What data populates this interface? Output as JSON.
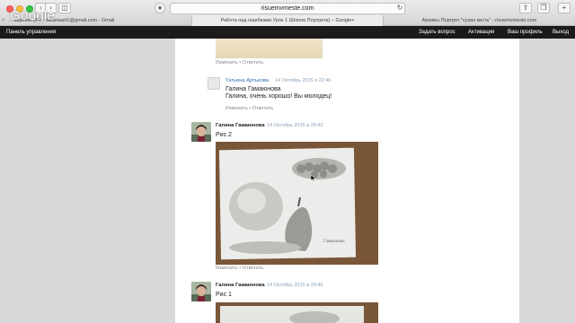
{
  "browser": {
    "url": "risuemvmeste.com",
    "tabs": [
      {
        "label": "…ащение (20) - tatianaart1@gmail.com - Gmail"
      },
      {
        "label": "Работа над ошибками Урок 1 (Школа Портрета) – Google+"
      },
      {
        "label": "Архивы Портрет \"сухая кисть\" - risuemvmeste.com"
      }
    ],
    "watermark": "Google"
  },
  "admin_bar": {
    "left": "Панель управления",
    "ask": "Задать вопрос",
    "activate": "Активация",
    "profile": "Ваш профиль",
    "logout": "Выход"
  },
  "comments": {
    "top_links": "Изменить • Ответить",
    "reply": {
      "author": "Татьяна Артькова",
      "date": "14 Октябрь 2015 в 22:46",
      "line1": "Галина Гамаюнова",
      "line2": "Галина, очень хорошо! Вы молодец!",
      "links": "Изменить • Ответить"
    },
    "c2": {
      "author": "Галина Гамаюнова",
      "date": "14 Октябрь 2015 в 20:42",
      "text": "Рис 2",
      "links": "Изменить • Ответить"
    },
    "c1": {
      "author": "Галина Гамаюнова",
      "date": "14 Октябрь 2015 в 20:40",
      "text": "Рис 1"
    }
  },
  "icons": [
    "back-icon",
    "forward-icon",
    "sidebar-icon",
    "shield-icon",
    "reload-icon",
    "share-icon",
    "tabs-icon",
    "new-tab-icon"
  ]
}
